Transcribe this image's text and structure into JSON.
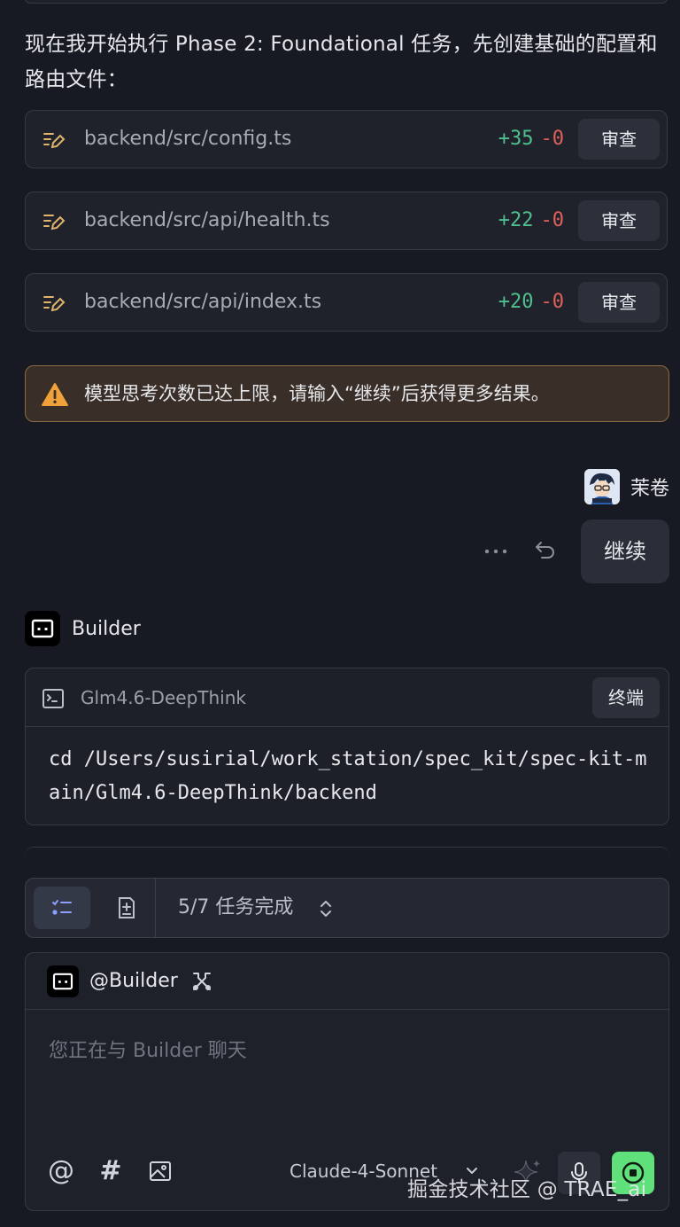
{
  "intro_text": "现在我开始执行 Phase 2: Foundational 任务，先创建基础的配置和路由文件：",
  "files": [
    {
      "path": "backend/src/config.ts",
      "added": "+35",
      "removed": "-0",
      "review_label": "审查"
    },
    {
      "path": "backend/src/api/health.ts",
      "added": "+22",
      "removed": "-0",
      "review_label": "审查"
    },
    {
      "path": "backend/src/api/index.ts",
      "added": "+20",
      "removed": "-0",
      "review_label": "审查"
    }
  ],
  "warning": {
    "text": "模型思考次数已达上限，请输入“继续”后获得更多结果。",
    "icon": "warning-triangle-icon"
  },
  "user": {
    "name": "茉卷",
    "message": "继续"
  },
  "assistant": {
    "name": "Builder"
  },
  "terminal": {
    "title": "Glm4.6-DeepThink",
    "button_label": "终端",
    "command": "cd /Users/susirial/work_station/spec_kit/spec-kit-main/Glm4.6-DeepThink/backend"
  },
  "tasks": {
    "status": "5/7 任务完成"
  },
  "composer": {
    "mention": "@Builder",
    "placeholder": "您正在与 Builder 聊天",
    "model": "Claude-4-Sonnet"
  },
  "watermark": "掘金技术社区 @ TRAE_ai",
  "colors": {
    "background": "#171a22",
    "card": "#1f222b",
    "added": "#4fc08d",
    "removed": "#e0605a",
    "warning_bg": "#3a2f28",
    "warning_icon": "#f0a13a",
    "stop_button": "#5fe07a"
  }
}
